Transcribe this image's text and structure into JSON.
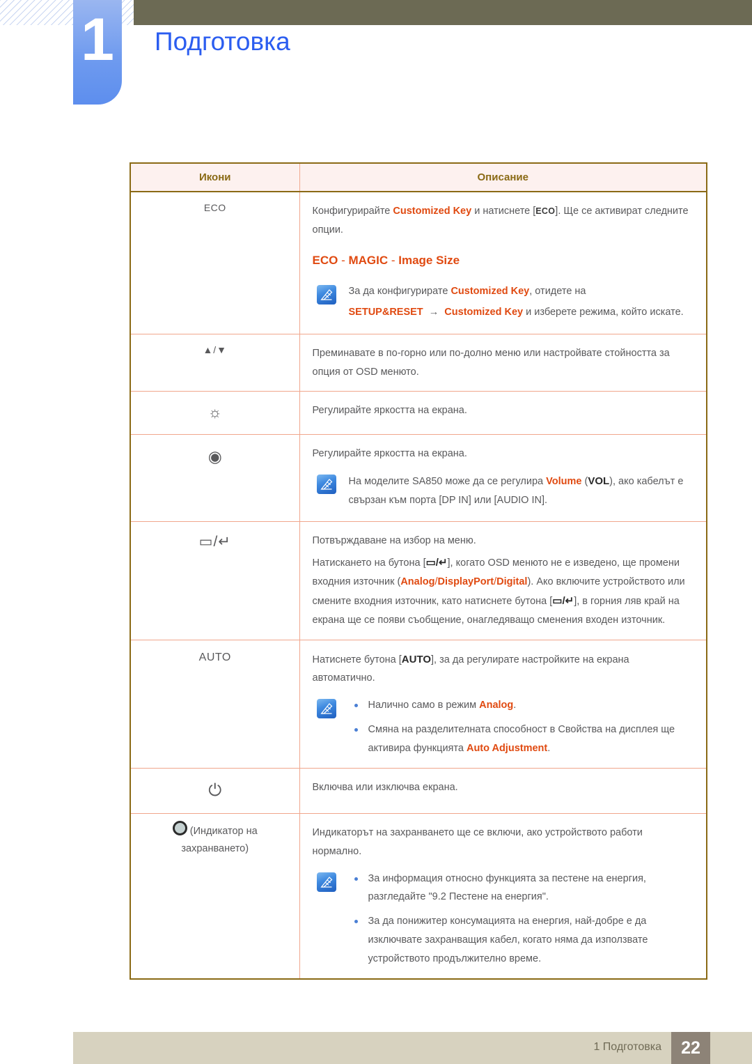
{
  "header": {
    "chapter_number": "1",
    "chapter_title": "Подготовка"
  },
  "table": {
    "columns": [
      "Икони",
      "Описание"
    ],
    "rows": [
      {
        "icon_label": "ECO",
        "icon_type": "text",
        "desc": {
          "p1_a": "Конфигурирайте ",
          "p1_b": "Customized Key",
          "p1_c": " и натиснете [",
          "p1_kbd": "ECO",
          "p1_d": "]. Ще се активират следните опции.",
          "highlight_line": {
            "a": "ECO",
            "sep1": " - ",
            "b": "MAGIC",
            "sep2": " - ",
            "c": "Image Size"
          },
          "note_line1_a": "За да конфигурирате ",
          "note_line1_b": "Customized Key",
          "note_line1_c": ", отидете на",
          "note_line2_a": "SETUP&RESET",
          "note_line2_arrow": "→",
          "note_line2_b": "Customized Key",
          "note_line2_c": " и изберете режима, който искате."
        }
      },
      {
        "icon_label": "▲/▼",
        "icon_type": "arrows",
        "desc": {
          "p1": "Преминавате в по-горно или по-долно меню или настройвате стойността за опция от OSD менюто."
        }
      },
      {
        "icon_label": "☼",
        "icon_type": "brightness",
        "desc": {
          "p1": "Регулирайте яркостта на екрана."
        }
      },
      {
        "icon_label": "◉",
        "icon_type": "volume-dot",
        "desc": {
          "p1": "Регулирайте яркостта на екрана.",
          "note_a": "На моделите SA850 може да се регулира ",
          "note_b": "Volume",
          "note_c": " (",
          "note_d": "VOL",
          "note_e": "), ако кабелът е свързан към порта [DP IN] или [AUDIO IN]."
        }
      },
      {
        "icon_label": "▭/↵",
        "icon_type": "menu-enter",
        "desc": {
          "p1": "Потвърждаване на избор на меню.",
          "p2_a": "Натискането на бутона [",
          "p2_kbd": "▭/↵",
          "p2_b": "], когато OSD менюто не е изведено, ще промени входния източник (",
          "p2_hl1": "Analog",
          "p2_slash1": "/",
          "p2_hl2": "DisplayPort",
          "p2_slash2": "/",
          "p2_hl3": "Digital",
          "p2_c": "). Ако включите устройството или смените входния източник, като натиснете бутона [",
          "p2_kbd2": "▭/↵",
          "p2_d": "], в горния ляв край на екрана ще се появи съобщение, онагледяващо сменения входен източник."
        }
      },
      {
        "icon_label": "AUTO",
        "icon_type": "text-auto",
        "desc": {
          "p1_a": "Натиснете бутона [",
          "p1_kbd": "AUTO",
          "p1_b": "], за да регулирате настройките на екрана автоматично.",
          "bullets": [
            {
              "a": "Налично само в режим ",
              "b": "Analog",
              "c": "."
            },
            {
              "a": "Смяна на разделителната способност в Свойства на дисплея ще активира функцията ",
              "b": "Auto Adjustment",
              "c": "."
            }
          ]
        }
      },
      {
        "icon_label": "⏻",
        "icon_type": "power",
        "desc": {
          "p1": "Включва или изключва екрана."
        }
      },
      {
        "icon_label": "(Индикатор на захранването)",
        "icon_label_line1": "(Индикатор на",
        "icon_label_line2": "захранването)",
        "icon_type": "led-indicator",
        "desc": {
          "p1": "Индикаторът на захранването ще се включи, ако устройството работи нормално.",
          "bullets": [
            {
              "a": "За информация относно функцията за пестене на енергия, разгледайте \"9.2 Пестене на енергия\"."
            },
            {
              "a": "За да понижитер консумацията на енергия, най-добре е да изключвате захранващия кабел, когато няма да използвате устройството продължително време."
            }
          ]
        }
      }
    ]
  },
  "footer": {
    "text": "1 Подготовка",
    "page": "22"
  },
  "colors": {
    "accent_orange": "#e04a11",
    "title_blue": "#2b5df0",
    "tab_blue": "#6f9bef",
    "olive": "#6c6a54",
    "table_border": "#8a6a15",
    "row_border": "#f0a68c",
    "header_bg": "#fdf1ef",
    "footer_bg": "#d7d2bf",
    "page_badge_bg": "#8d8377"
  }
}
